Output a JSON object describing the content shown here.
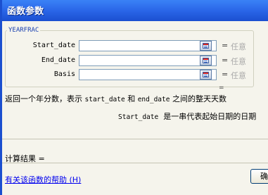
{
  "dialog": {
    "title": "函数参数",
    "function_name": "YEARFRAC",
    "args": [
      {
        "label": "Start_date",
        "value": "",
        "eq": "=",
        "hint": "任意"
      },
      {
        "label": "End_date",
        "value": "",
        "eq": "=",
        "hint": "任意"
      },
      {
        "label": "Basis",
        "value": "",
        "eq": "=",
        "hint": "任意"
      }
    ],
    "result_eq": "=",
    "description": {
      "prefix": "返回一个年分数，表示 ",
      "arg1": "start_date",
      "mid": " 和 ",
      "arg2": "end_date",
      "suffix": " 之间的整天天数"
    },
    "arg_description": {
      "name": "Start_date",
      "text": "  是一串代表起始日期的日期"
    },
    "result_label": "计算结果 =",
    "help_link": "有关该函数的帮助 (H)",
    "ok_button": "确"
  }
}
